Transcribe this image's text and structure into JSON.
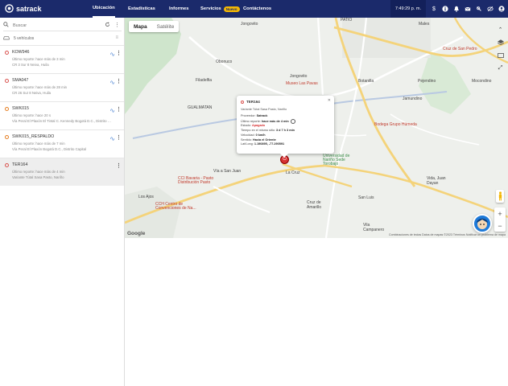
{
  "header": {
    "logo_text": "satrack",
    "nav": [
      {
        "label": "Ubicación",
        "active": true
      },
      {
        "label": "Estadísticas"
      },
      {
        "label": "Informes"
      },
      {
        "label": "Servicios",
        "badge": "Nuevo"
      },
      {
        "label": "Contáctenos"
      }
    ],
    "time": "7:49:29 p. m.",
    "icons": [
      "dollar-icon",
      "info-icon",
      "bell-icon",
      "mail-icon",
      "pin-off-icon",
      "eye-off-icon",
      "user-icon"
    ]
  },
  "sidebar": {
    "search_placeholder": "Buscar",
    "vehicle_count": "5 vehículos",
    "vehicles": [
      {
        "name": "KOW946",
        "report": "Último reporte: hace más de 3 min",
        "address": "CR 3 Sur  8 Neiva, Huila",
        "selected": false
      },
      {
        "name": "SMA047",
        "report": "Último reporte: hace más de 28 min",
        "address": "CR 26 Sur  8 Neiva, Huila",
        "selected": false
      },
      {
        "name": "SWK015",
        "report": "Último reporte: hace 20 s",
        "address": "Vía Peral El Plaxón  El Tintal  C. Kennedy Bogotá D.C., Distrito Ca...",
        "selected": false
      },
      {
        "name": "SWK015_RESPALDO",
        "report": "Último reporte: hace más de 7 min",
        "address": "Vía Peral El Plaxón Bogotá D.C., Distrito Capital",
        "selected": false
      },
      {
        "name": "TER164",
        "report": "Último reporte: hace más de 4 min",
        "address": "Variante Tútal Sasa Pasto, Nariño",
        "selected": true
      }
    ]
  },
  "map": {
    "tabs": [
      "Mapa",
      "Satélite"
    ],
    "active_tab": "Mapa",
    "labels": [
      {
        "text": "Jongovito",
        "kind": "plain"
      },
      {
        "text": "Obonuco",
        "kind": "plain"
      },
      {
        "text": "Filadelfia",
        "kind": "plain"
      },
      {
        "text": "Jongovito",
        "kind": "plain"
      },
      {
        "text": "Museo Las Pavas",
        "kind": "poi"
      },
      {
        "text": "Botanilla",
        "kind": "plain"
      },
      {
        "text": "Pejendino",
        "kind": "plain"
      },
      {
        "text": "Mocondino",
        "kind": "plain"
      },
      {
        "text": "Jamundino",
        "kind": "plain"
      },
      {
        "text": "Bodega Grupo Húmeda",
        "kind": "poi"
      },
      {
        "text": "GUALMATAN",
        "kind": "plain"
      },
      {
        "text": "La Cruz",
        "kind": "plain"
      },
      {
        "text": "Universidad de Nariño Sede Torobajo",
        "kind": "green"
      },
      {
        "text": "CCI Bavaria - Pasto Distribución Pasto",
        "kind": "poi"
      },
      {
        "text": "Vía a San Juan",
        "kind": "plain"
      },
      {
        "text": "Vida, Juan Dayan",
        "kind": "plain"
      },
      {
        "text": "San Luis",
        "kind": "plain"
      },
      {
        "text": "Los Ajos",
        "kind": "plain"
      },
      {
        "text": "CCH Centro de Convenciones de Na...",
        "kind": "poi"
      },
      {
        "text": "Cruz de Amarillo",
        "kind": "plain"
      },
      {
        "text": "Vila Campanero",
        "kind": "plain"
      },
      {
        "text": "Males",
        "kind": "plain"
      },
      {
        "text": "Cruz de San Pedro",
        "kind": "poi"
      },
      {
        "text": "PATIO",
        "kind": "plain"
      }
    ],
    "attribution": "Combinaciones de teclas    Datos de mapas ©2023    Términos    Notificar un problema de mapa",
    "google_text": "Google",
    "popup": {
      "title": "TER164",
      "subtitle": "Variante Tútal Sasa Pasto, Nariño",
      "rows": [
        {
          "label": "Proveedor:",
          "value": "Satrack"
        },
        {
          "label": "Último reporte:",
          "value": "hace más de 4 min"
        },
        {
          "label": "Estado:",
          "value": "Apagado"
        },
        {
          "label": "Tiempo en el mismo sitio:",
          "value": "3 d 7 h 3 min"
        },
        {
          "label": "Velocidad:",
          "value": "0 km/h"
        },
        {
          "label": "Sentido:",
          "value": "Hacia el Oriente"
        },
        {
          "label": "Lat/Long:",
          "value": "1.190895, -77.290591"
        }
      ]
    }
  }
}
